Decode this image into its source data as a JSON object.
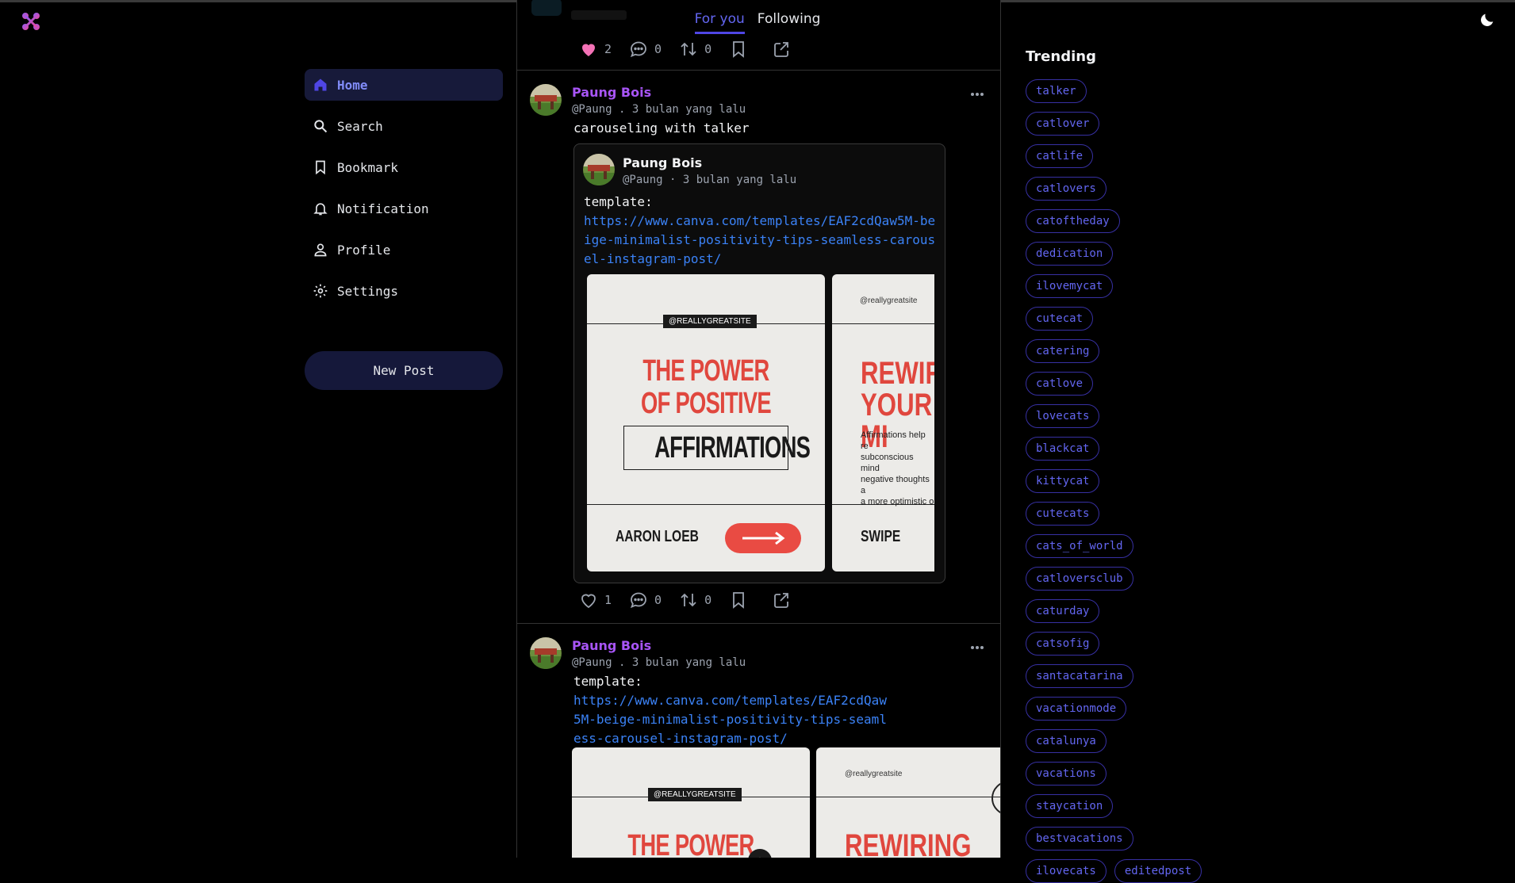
{
  "top_tabs": [
    "For you",
    "Following"
  ],
  "sidebar": {
    "items": [
      {
        "label": "Home",
        "icon": "home-icon"
      },
      {
        "label": "Search",
        "icon": "search-icon"
      },
      {
        "label": "Bookmark",
        "icon": "bookmark-icon"
      },
      {
        "label": "Notification",
        "icon": "bell-icon"
      },
      {
        "label": "Profile",
        "icon": "user-icon"
      },
      {
        "label": "Settings",
        "icon": "gear-icon"
      }
    ],
    "new_post_label": "New Post"
  },
  "colors": {
    "accent": "#6366f1",
    "author": "#a855f7",
    "link": "#3b82f6",
    "like": "#f472b6",
    "poster_red": "#e0473e"
  },
  "posts": [
    {
      "likes": "2",
      "comments": "0",
      "reposts": "0",
      "liked": true
    },
    {
      "author": "Paung Bois",
      "meta": "@Paung . 3 bulan yang lalu",
      "text": "carouseling with talker",
      "likes": "1",
      "comments": "0",
      "reposts": "0",
      "quote": {
        "author": "Paung Bois",
        "meta": "@Paung · 3 bulan yang lalu",
        "text": "template:",
        "link": "https://www.canva.com/templates/EAF2cdQaw5M-beige-minimalist-positivity-tips-seamless-carousel-instagram-post/"
      }
    },
    {
      "author": "Paung Bois",
      "meta": "@Paung . 3 bulan yang lalu",
      "text": "template:",
      "link": "https://www.canva.com/templates/EAF2cdQaw5M-beige-minimalist-positivity-tips-seamless-carousel-instagram-post/"
    }
  ],
  "slides": {
    "handle_upper": "@REALLYGREATSITE",
    "handle_lower": "@reallygreatsite",
    "title_line1": "THE POWER",
    "title_line2": "OF POSITIVE",
    "title_box": "AFFIRMATIONS",
    "footer_name": "AARON LOEB",
    "slide2_title1": "REWIRIN",
    "slide2_title2": "YOUR MI",
    "slide2_title_full": "REWIRING",
    "slide2_para": [
      "Affirmations help re",
      "subconscious mind",
      "negative thoughts a",
      "a more optimistic o"
    ],
    "slide2_footer": "SWIPE"
  },
  "trending": {
    "title": "Trending",
    "tags": [
      "talker",
      "catlover",
      "catlife",
      "catlovers",
      "catoftheday",
      "dedication",
      "ilovemycat",
      "cutecat",
      "catering",
      "catlove",
      "lovecats",
      "blackcat",
      "kittycat",
      "cutecats",
      "cats_of_world",
      "catloversclub",
      "caturday",
      "catsofig",
      "santacatarina",
      "vacationmode",
      "catalunya",
      "vacations",
      "staycation",
      "bestvacations",
      "ilovecats",
      "editedpost"
    ]
  }
}
